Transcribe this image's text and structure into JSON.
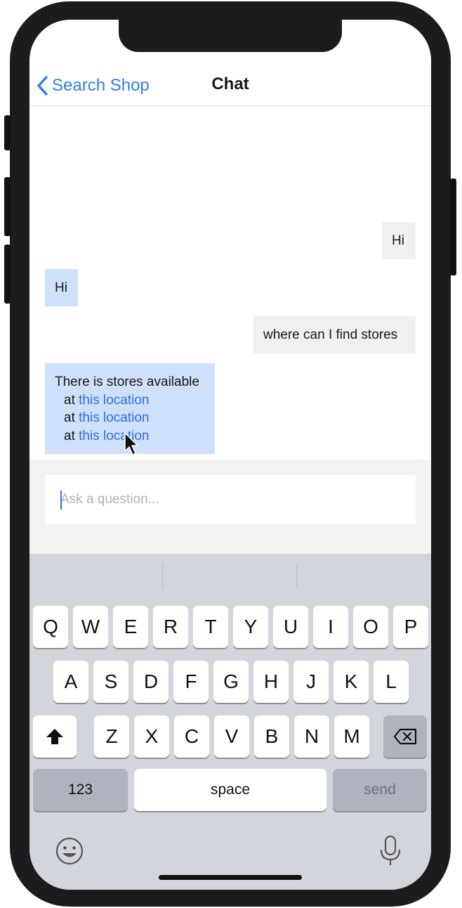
{
  "nav": {
    "back_label": "Search Shop",
    "title": "Chat"
  },
  "messages": [
    {
      "sender": "user",
      "text": "Hi"
    },
    {
      "sender": "bot",
      "text": "Hi"
    },
    {
      "sender": "user",
      "text": "where can I find stores"
    },
    {
      "sender": "bot",
      "intro": "There is stores available",
      "lines": [
        {
          "prefix": "at",
          "link": "this location"
        },
        {
          "prefix": "at",
          "link": "this location"
        },
        {
          "prefix": "at",
          "link": "this location"
        }
      ]
    }
  ],
  "input": {
    "placeholder": "Ask a question...",
    "value": ""
  },
  "keyboard": {
    "row1": [
      "Q",
      "W",
      "E",
      "R",
      "T",
      "Y",
      "U",
      "I",
      "O",
      "P"
    ],
    "row2": [
      "A",
      "S",
      "D",
      "F",
      "G",
      "H",
      "J",
      "K",
      "L"
    ],
    "row3": [
      "Z",
      "X",
      "C",
      "V",
      "B",
      "N",
      "M"
    ],
    "numbers_label": "123",
    "space_label": "space",
    "send_label": "send"
  },
  "colors": {
    "link": "#2f6fe0",
    "bot_bubble": "#cfe0fb",
    "user_bubble": "#f1f0ee",
    "accent": "#2f7fe8"
  }
}
